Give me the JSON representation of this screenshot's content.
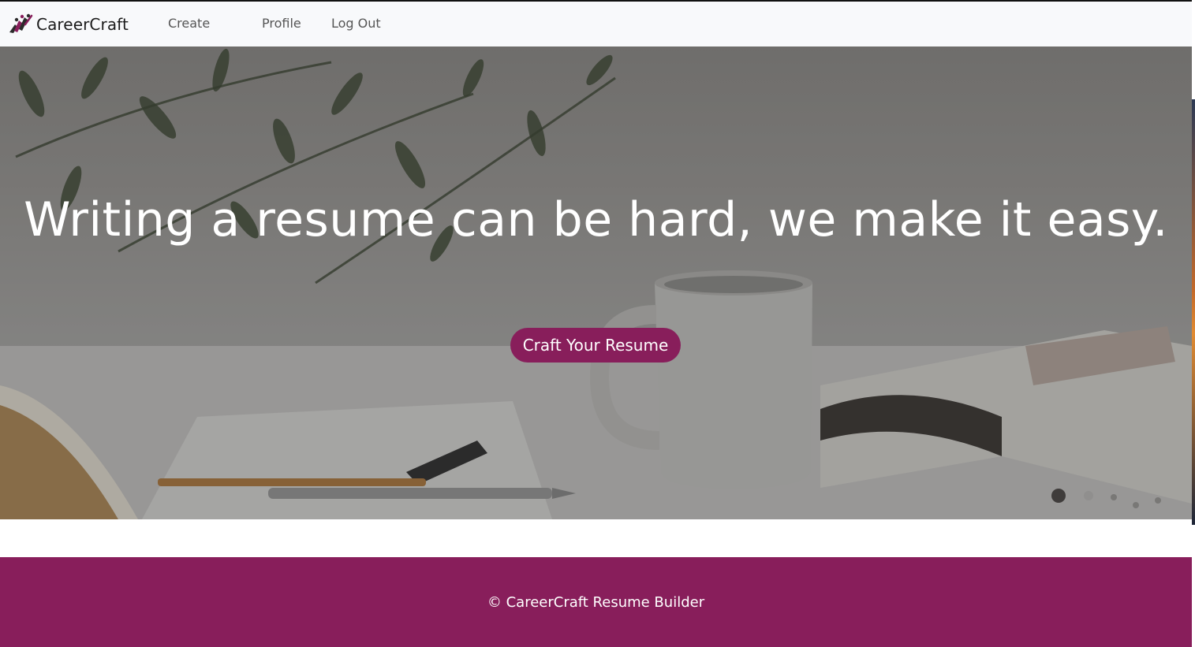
{
  "brand": {
    "name": "CareerCraft",
    "logo_icon": "running-figures-logo-icon"
  },
  "nav": {
    "create": "Create",
    "profile": "Profile",
    "logout": "Log Out"
  },
  "hero": {
    "title": "Writing a resume can be hard, we make it easy.",
    "cta_label": "Craft Your Resume"
  },
  "footer": {
    "text": "© CareerCraft Resume Builder"
  },
  "colors": {
    "accent": "#881e5b",
    "navbar_bg": "#f8f9fb",
    "hero_text": "#ffffff"
  }
}
